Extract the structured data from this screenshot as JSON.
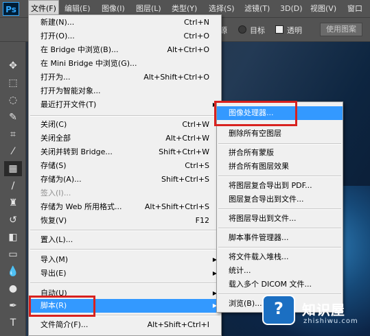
{
  "app_logo": "Ps",
  "menubar": [
    "文件(F)",
    "编辑(E)",
    "图像(I)",
    "图层(L)",
    "类型(Y)",
    "选择(S)",
    "滤镜(T)",
    "3D(D)",
    "视图(V)",
    "窗口"
  ],
  "options_bar": {
    "source_label": "源",
    "target_label": "目标",
    "transparent_label": "透明",
    "use_pattern_label": "使用图案"
  },
  "file_menu": [
    {
      "label": "新建(N)...",
      "shortcut": "Ctrl+N"
    },
    {
      "label": "打开(O)...",
      "shortcut": "Ctrl+O"
    },
    {
      "label": "在 Bridge 中浏览(B)...",
      "shortcut": "Alt+Ctrl+O"
    },
    {
      "label": "在 Mini Bridge 中浏览(G)...",
      "shortcut": ""
    },
    {
      "label": "打开为...",
      "shortcut": "Alt+Shift+Ctrl+O"
    },
    {
      "label": "打开为智能对象...",
      "shortcut": ""
    },
    {
      "label": "最近打开文件(T)",
      "shortcut": ""
    },
    {
      "label": "关闭(C)",
      "shortcut": "Ctrl+W"
    },
    {
      "label": "关闭全部",
      "shortcut": "Alt+Ctrl+W"
    },
    {
      "label": "关闭并转到 Bridge...",
      "shortcut": "Shift+Ctrl+W"
    },
    {
      "label": "存储(S)",
      "shortcut": "Ctrl+S"
    },
    {
      "label": "存储为(A)...",
      "shortcut": "Shift+Ctrl+S"
    },
    {
      "label": "签入(I)...",
      "shortcut": ""
    },
    {
      "label": "存储为 Web 所用格式...",
      "shortcut": "Alt+Shift+Ctrl+S"
    },
    {
      "label": "恢复(V)",
      "shortcut": "F12"
    },
    {
      "label": "置入(L)...",
      "shortcut": ""
    },
    {
      "label": "导入(M)",
      "shortcut": ""
    },
    {
      "label": "导出(E)",
      "shortcut": ""
    },
    {
      "label": "自动(U)",
      "shortcut": ""
    },
    {
      "label": "脚本(R)",
      "shortcut": ""
    },
    {
      "label": "文件简介(F)...",
      "shortcut": "Alt+Shift+Ctrl+I"
    }
  ],
  "script_menu": [
    "图像处理器...",
    "删除所有空图层",
    "拼合所有蒙版",
    "拼合所有图层效果",
    "将图层复合导出到 PDF...",
    "图层复合导出到文件...",
    "将图层导出到文件...",
    "脚本事件管理器...",
    "将文件载入堆栈...",
    "统计...",
    "载入多个 DICOM 文件...",
    "浏览(B)..."
  ],
  "watermark": {
    "icon": "?",
    "title": "知识屋",
    "subtitle": "zhishiwu.com"
  },
  "colors": {
    "highlight": "#3399ff",
    "annotation_box": "#d8211e",
    "app_chrome": "#535353"
  },
  "toolbar_icons": [
    "move-icon",
    "marquee-icon",
    "lasso-icon",
    "quick-select-icon",
    "crop-icon",
    "eyedropper-icon",
    "healing-brush-icon",
    "brush-icon",
    "clone-stamp-icon",
    "history-brush-icon",
    "eraser-icon",
    "gradient-icon",
    "blur-icon",
    "dodge-icon",
    "pen-icon",
    "type-icon"
  ]
}
